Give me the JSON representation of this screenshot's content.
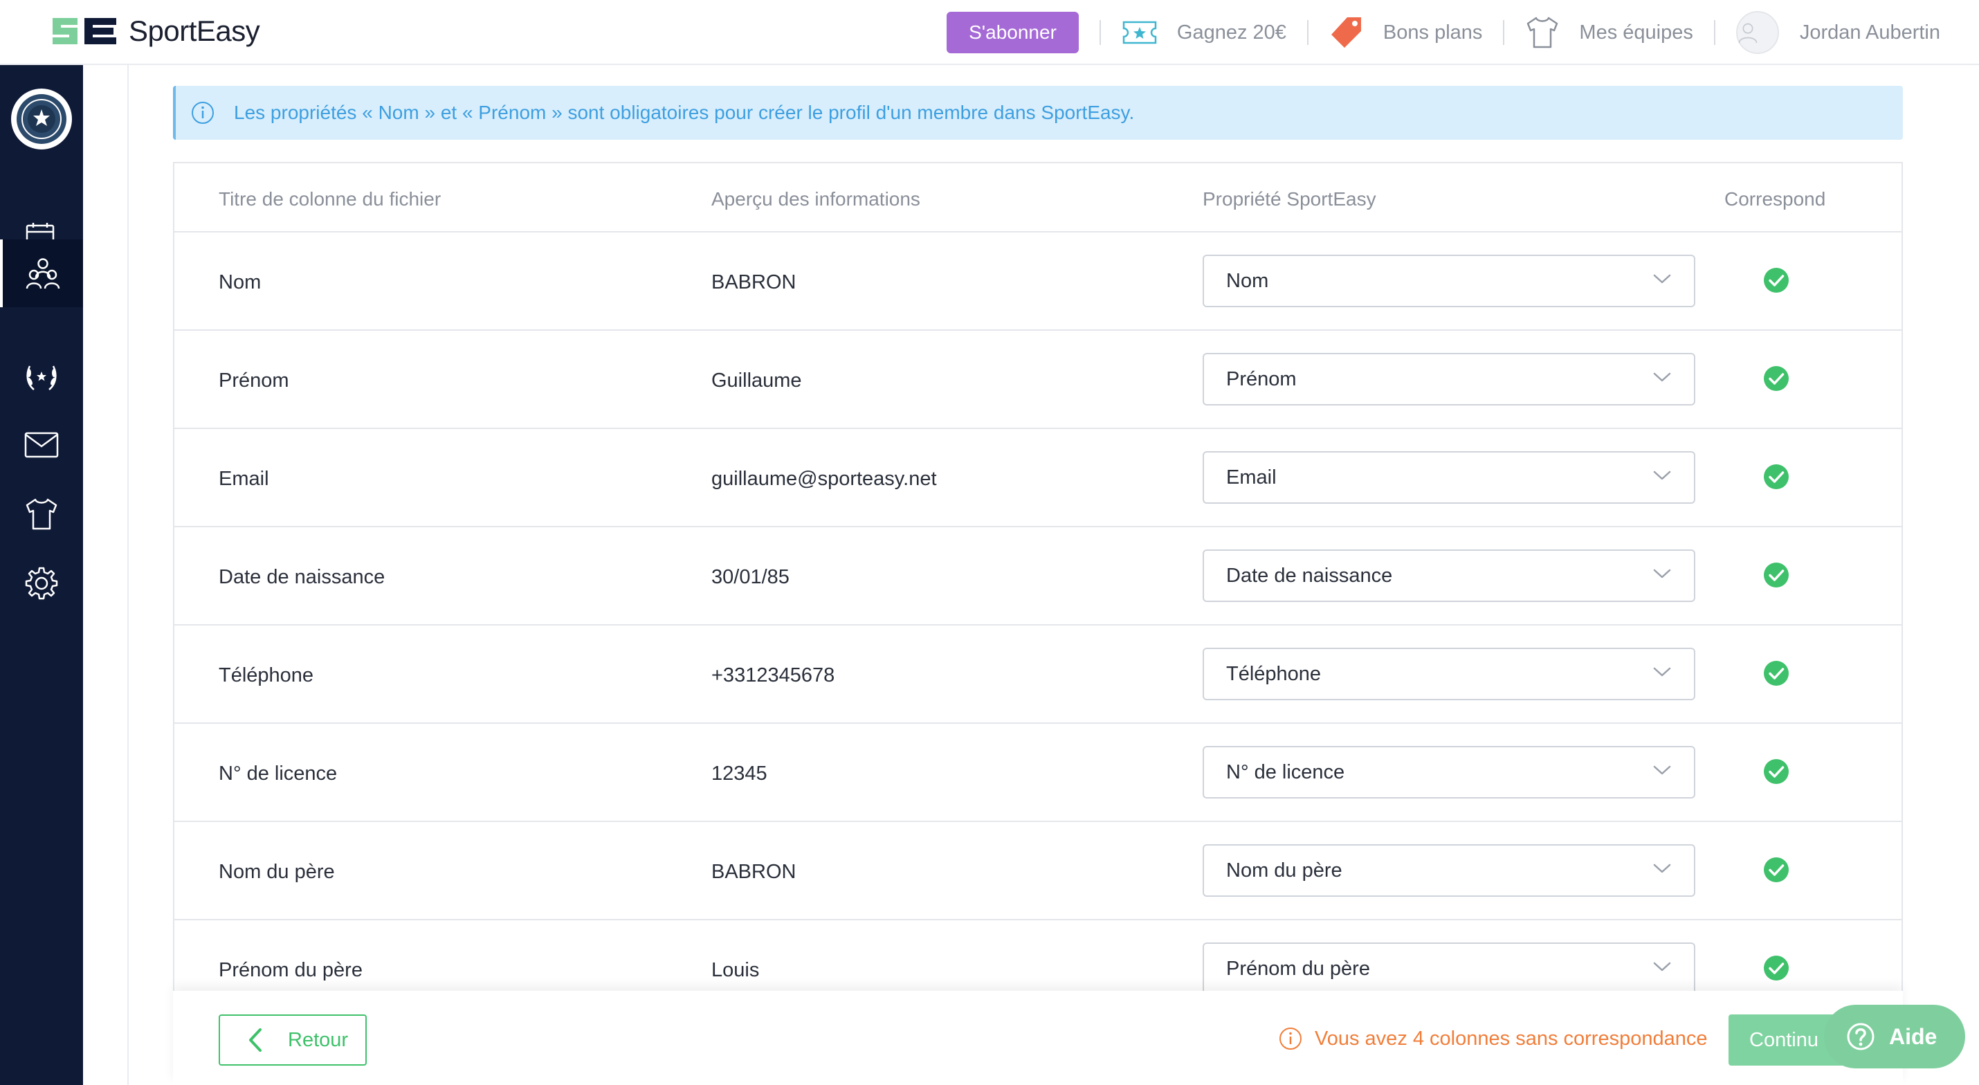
{
  "app": {
    "name": "SportEasy"
  },
  "header": {
    "subscribe_label": "S'abonner",
    "referral_label": "Gagnez 20€",
    "deals_label": "Bons plans",
    "teams_label": "Mes équipes",
    "user_name": "Jordan Aubertin"
  },
  "sidebar": {
    "items": [
      {
        "name": "calendar-icon",
        "active": false
      },
      {
        "name": "members-icon",
        "active": true
      },
      {
        "name": "laurel-icon",
        "active": false
      },
      {
        "name": "mail-icon",
        "active": false
      },
      {
        "name": "jersey-icon",
        "active": false
      },
      {
        "name": "gear-icon",
        "active": false
      }
    ]
  },
  "info_banner": {
    "text": "Les propriétés « Nom » et « Prénom » sont obligatoires pour créer le profil d'un membre dans SportEasy."
  },
  "table": {
    "headers": {
      "file_column": "Titre de colonne du fichier",
      "preview": "Aperçu des informations",
      "property": "Propriété SportEasy",
      "match": "Correspond"
    },
    "rows": [
      {
        "column": "Nom",
        "preview": "BABRON",
        "property": "Nom",
        "matched": true
      },
      {
        "column": "Prénom",
        "preview": "Guillaume",
        "property": "Prénom",
        "matched": true
      },
      {
        "column": "Email",
        "preview": "guillaume@sporteasy.net",
        "property": "Email",
        "matched": true
      },
      {
        "column": "Date de naissance",
        "preview": "30/01/85",
        "property": "Date de naissance",
        "matched": true
      },
      {
        "column": "Téléphone",
        "preview": "+3312345678",
        "property": "Téléphone",
        "matched": true
      },
      {
        "column": "N° de licence",
        "preview": "12345",
        "property": "N° de licence",
        "matched": true
      },
      {
        "column": "Nom du père",
        "preview": "BABRON",
        "property": "Nom du père",
        "matched": true
      },
      {
        "column": "Prénom du père",
        "preview": "Louis",
        "property": "Prénom du père",
        "matched": true
      }
    ]
  },
  "footer": {
    "back_label": "Retour",
    "warning_text": "Vous avez 4 colonnes sans correspondance",
    "continue_label": "Continu",
    "help_label": "Aide"
  },
  "colors": {
    "accent_purple": "#a56ad6",
    "sidebar_bg": "#0f1a36",
    "success_green": "#3ec16a",
    "warning_orange": "#f07e3a",
    "info_blue": "#3d9fe0"
  }
}
